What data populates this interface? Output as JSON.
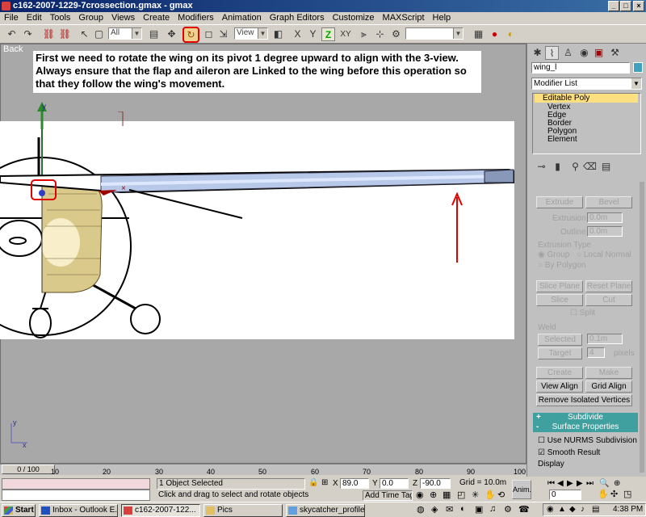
{
  "window": {
    "title": "c162-2007-1229-7crossection.gmax - gmax"
  },
  "menu": [
    "File",
    "Edit",
    "Tools",
    "Group",
    "Views",
    "Create",
    "Modifiers",
    "Animation",
    "Graph Editors",
    "Customize",
    "MAXScript",
    "Help"
  ],
  "toolbar": {
    "selection_filter": "All",
    "coord_system": "View"
  },
  "viewport": {
    "label": "Back",
    "note": "First we need to rotate the wing on its pivot 1 degree upward to align with the 3-view.  Always ensure that the flap and aileron are  Linked to the wing before this operation so that they follow the wing's movement.",
    "axis_x": "x",
    "axis_y": "y"
  },
  "panel": {
    "object_name": "wing_l",
    "modifier_list": "Modifier List",
    "stack": [
      "Editable Poly",
      "Vertex",
      "Edge",
      "Border",
      "Polygon",
      "Element"
    ],
    "extrude": "Extrude",
    "bevel": "Bevel",
    "extrusion_label": "Extrusion",
    "extrusion_value": "0.0m",
    "outline_label": "Outline",
    "outline_value": "0.0m",
    "extrusion_type": "Extrusion Type",
    "group": "Group",
    "local_normal": "Local Normal",
    "by_polygon": "By Polygon",
    "slice_plane": "Slice Plane",
    "reset_plane": "Reset Plane",
    "slice": "Slice",
    "cut": "Cut",
    "split": "Split",
    "weld": "Weld",
    "selected": "Selected",
    "selected_value": "0.1m",
    "target": "Target",
    "target_value": "4",
    "pixels": "pixels",
    "create_shape": "Create Shape",
    "make_planar": "Make Planar",
    "view_align": "View Align",
    "grid_align": "Grid Align",
    "remove_isolated": "Remove Isolated Vertices",
    "subdivide": "Subdivide",
    "surface_properties": "Surface Properties",
    "use_nurms": "Use NURMS Subdivision",
    "smooth_result": "Smooth Result",
    "display": "Display",
    "plus": "+",
    "minus": "-"
  },
  "timeline": {
    "frame": "0 / 100",
    "ticks": [
      "10",
      "20",
      "30",
      "40",
      "50",
      "60",
      "70",
      "80",
      "90",
      "100"
    ],
    "progress": 0.0
  },
  "status": {
    "selected": "1 Object Selected",
    "prompt": "Click and drag to select and rotate objects",
    "x_label": "X",
    "x_value": "89.0",
    "y_label": "Y",
    "y_value": "0.0",
    "z_label": "Z",
    "z_value": "-90.0",
    "grid": "Grid = 10.0m",
    "add_time_tag": "Add Time Tag",
    "anim": "Anim.",
    "frame_field": "0"
  },
  "taskbar": {
    "start": "Start",
    "tasks": [
      "Inbox - Outlook E...",
      "c162-2007-122...",
      "Pics",
      "skycatcher_profile..."
    ],
    "clock": "4:38 PM"
  },
  "colors": {
    "accent_red": "#ff0000",
    "title_start": "#0a246a",
    "title_end": "#3a6ea5",
    "rollout": "#40a0a0"
  }
}
